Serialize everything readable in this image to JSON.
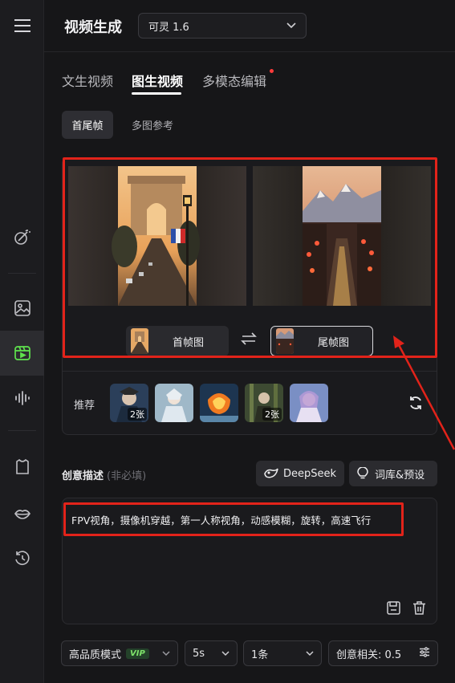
{
  "header": {
    "title": "视频生成",
    "model": "可灵 1.6"
  },
  "tabs": [
    {
      "label": "文生视频",
      "active": false
    },
    {
      "label": "图生视频",
      "active": true
    },
    {
      "label": "多模态编辑",
      "active": false,
      "badge": "red-dot"
    }
  ],
  "subtabs": [
    {
      "label": "首尾帧",
      "active": true
    },
    {
      "label": "多图参考",
      "active": false
    }
  ],
  "frames": {
    "first_label": "首帧图",
    "last_label": "尾帧图",
    "swap_icon": "swap-arrows-icon"
  },
  "recommend": {
    "label": "推荐",
    "items": [
      {
        "count": "2张"
      },
      {
        "count": ""
      },
      {
        "count": ""
      },
      {
        "count": "2张"
      },
      {
        "count": ""
      }
    ]
  },
  "prompt": {
    "title": "创意描述",
    "optional": "(非必填)",
    "deepseek_label": "DeepSeek",
    "library_label": "词库&预设",
    "text": "FPV视角，摄像机穿越，第一人称视角，动感模糊，旋转，高速飞行"
  },
  "bottom": {
    "mode": "高品质模式",
    "vip": "VIP",
    "duration": "5s",
    "count": "1条",
    "relevance": "创意相关: 0.5"
  },
  "colors": {
    "accent_green": "#5fe34d",
    "annotation_red": "#e2231a",
    "badge_red": "#ff3b3b"
  }
}
